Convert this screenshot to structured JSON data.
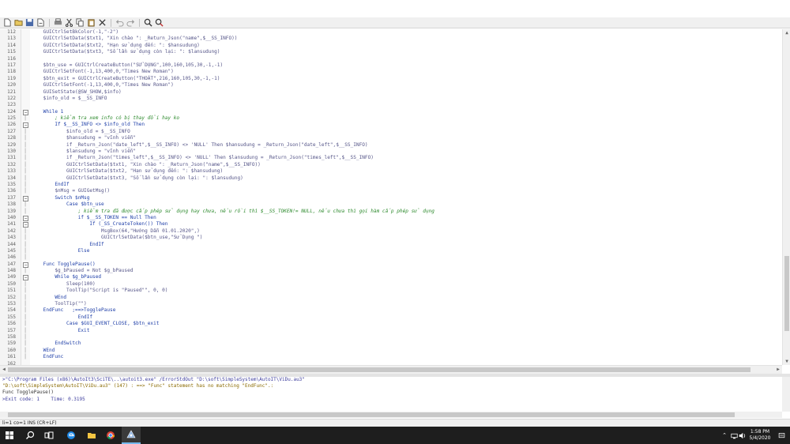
{
  "toolbar": {
    "icons": [
      "new-file-icon",
      "open-file-icon",
      "save-icon",
      "save-as-icon",
      "print-icon",
      "cut-icon",
      "copy-icon",
      "paste-icon",
      "close-icon",
      "undo-icon",
      "redo-icon",
      "find-icon",
      "replace-icon"
    ]
  },
  "code_lines": [
    {
      "n": "112",
      "t": "    GUICtrlSetBkColor(-1,\"-2\")",
      "k": "fn",
      "f": ""
    },
    {
      "n": "113",
      "t": "    GUICtrlSetData($txt1, \"Xin chào \": _Return_Json(\"name\",$__SS_INFO))",
      "k": "fn",
      "f": ""
    },
    {
      "n": "114",
      "t": "    GUICtrlSetData($txt2, \"Hạn sử dụng đến: \": $hansudung)",
      "k": "fn",
      "f": ""
    },
    {
      "n": "115",
      "t": "    GUICtrlSetData($txt3, \"Số lần sử dụng còn lại: \": $lansudung)",
      "k": "fn",
      "f": ""
    },
    {
      "n": "116",
      "t": "",
      "k": "fn",
      "f": ""
    },
    {
      "n": "117",
      "t": "    $btn_use = GUICtrlCreateButton(\"SỬ DỤNG\",100,160,105,30,-1,-1)",
      "k": "fn",
      "f": ""
    },
    {
      "n": "118",
      "t": "    GUICtrlSetFont(-1,13,400,0,\"Times New Roman\")",
      "k": "fn",
      "f": ""
    },
    {
      "n": "119",
      "t": "    $btn_exit = GUICtrlCreateButton(\"THOÁT\",216,160,105,30,-1,-1)",
      "k": "fn",
      "f": ""
    },
    {
      "n": "120",
      "t": "    GUICtrlSetFont(-1,13,400,0,\"Times New Roman\")",
      "k": "fn",
      "f": ""
    },
    {
      "n": "121",
      "t": "    GUISetState(@SW_SHOW,$info)",
      "k": "fn",
      "f": ""
    },
    {
      "n": "122",
      "t": "    $info_old = $__SS_INFO",
      "k": "fn",
      "f": ""
    },
    {
      "n": "123",
      "t": "",
      "k": "fn",
      "f": ""
    },
    {
      "n": "124",
      "t": "    While 1",
      "k": "kw",
      "f": "box"
    },
    {
      "n": "125",
      "t": "        ; kiểm tra xem info có bị thay đổi hay ko",
      "k": "cm",
      "f": "line"
    },
    {
      "n": "126",
      "t": "        If $__SS_INFO <> $info_old Then",
      "k": "kw",
      "f": "box"
    },
    {
      "n": "127",
      "t": "            $info_old = $__SS_INFO",
      "k": "fn",
      "f": "line"
    },
    {
      "n": "128",
      "t": "            $hansudung = \"vĩnh viễn\"",
      "k": "fn",
      "f": "line"
    },
    {
      "n": "129",
      "t": "            if _Return_Json(\"date_left\",$__SS_INFO) <> 'NULL' Then $hansudung = _Return_Json(\"date_left\",$__SS_INFO)",
      "k": "fn",
      "f": "line"
    },
    {
      "n": "130",
      "t": "            $lansudung = \"vĩnh viễn\"",
      "k": "fn",
      "f": "line"
    },
    {
      "n": "131",
      "t": "            if _Return_Json(\"times_left\",$__SS_INFO) <> 'NULL' Then $lansudung = _Return_Json(\"times_left\",$__SS_INFO)",
      "k": "fn",
      "f": "line"
    },
    {
      "n": "132",
      "t": "            GUICtrlSetData($txt1, \"Xin chào \": _Return_Json(\"name\",$__SS_INFO))",
      "k": "fn",
      "f": "line"
    },
    {
      "n": "133",
      "t": "            GUICtrlSetData($txt2, \"Hạn sử dụng đến: \": $hansudung)",
      "k": "fn",
      "f": "line"
    },
    {
      "n": "134",
      "t": "            GUICtrlSetData($txt3, \"Số lần sử dụng còn lại: \": $lansudung)",
      "k": "fn",
      "f": "line"
    },
    {
      "n": "135",
      "t": "        EndIf",
      "k": "kw",
      "f": "line"
    },
    {
      "n": "136",
      "t": "        $nMsg = GUIGetMsg()",
      "k": "fn",
      "f": "line"
    },
    {
      "n": "137",
      "t": "        Switch $nMsg",
      "k": "kw",
      "f": "box"
    },
    {
      "n": "138",
      "t": "            Case $btn_use",
      "k": "kw",
      "f": "line"
    },
    {
      "n": "139",
      "t": "                ; kiểm tra đã được cấp phép sử dụng hay chưa, nếu rồi thì $__SS_TOKEN!= NULL, nếu chưa thì gọi hàm cấp phép sử dụng",
      "k": "cm",
      "f": "line"
    },
    {
      "n": "140",
      "t": "                if $__SS_TOKEN == Null Then",
      "k": "kw",
      "f": "box"
    },
    {
      "n": "141",
      "t": "                    If (_SS_CreateToken()) Then",
      "k": "kw",
      "f": "box"
    },
    {
      "n": "142",
      "t": "                        MsgBox(64,\"Hướng Dẫn 01.01.2020\",)",
      "k": "fn",
      "f": "line"
    },
    {
      "n": "143",
      "t": "                        GUICtrlSetData($btn_use,\"Sử Dụng \")",
      "k": "fn",
      "f": "line"
    },
    {
      "n": "144",
      "t": "                    EndIf",
      "k": "kw",
      "f": "line"
    },
    {
      "n": "145",
      "t": "                Else",
      "k": "kw",
      "f": "line"
    },
    {
      "n": "146",
      "t": "",
      "k": "fn",
      "f": "line"
    },
    {
      "n": "147",
      "t": "    Func TogglePause()",
      "k": "kw",
      "f": "box"
    },
    {
      "n": "148",
      "t": "        $g_bPaused = Not $g_bPaused",
      "k": "fn",
      "f": "line"
    },
    {
      "n": "149",
      "t": "        While $g_bPaused",
      "k": "kw",
      "f": "box"
    },
    {
      "n": "150",
      "t": "            Sleep(100)",
      "k": "fn",
      "f": "line"
    },
    {
      "n": "151",
      "t": "            ToolTip(\"Script is \"Paused\"\", 0, 0)",
      "k": "fn",
      "f": "line"
    },
    {
      "n": "152",
      "t": "        WEnd",
      "k": "kw",
      "f": "line"
    },
    {
      "n": "153",
      "t": "        ToolTip(\"\")",
      "k": "fn",
      "f": "line"
    },
    {
      "n": "154",
      "t": "    EndFunc   ;==>TogglePause",
      "k": "kw",
      "f": "line"
    },
    {
      "n": "155",
      "t": "                EndIf",
      "k": "kw",
      "f": "line"
    },
    {
      "n": "156",
      "t": "            Case $GUI_EVENT_CLOSE, $btn_exit",
      "k": "kw",
      "f": "line"
    },
    {
      "n": "157",
      "t": "                Exit",
      "k": "kw",
      "f": "line"
    },
    {
      "n": "158",
      "t": "",
      "k": "fn",
      "f": "line"
    },
    {
      "n": "159",
      "t": "        EndSwitch",
      "k": "kw",
      "f": "line"
    },
    {
      "n": "160",
      "t": "    WEnd",
      "k": "kw",
      "f": "line"
    },
    {
      "n": "161",
      "t": "    EndFunc",
      "k": "kw",
      "f": "line"
    },
    {
      "n": "162",
      "t": "",
      "k": "fn",
      "f": ""
    }
  ],
  "output": {
    "line1": ">\"C:\\Program Files (x86)\\AutoIt3\\SciTE\\..\\autoit3.exe\" /ErrorStdOut \"D:\\soft\\SimpleSystem\\AutoIT\\ViDu.au3\"",
    "line2": "\"D:\\soft\\SimpleSystem\\AutoIT\\ViDu.au3\" (147) : ==> \"Func\" statement has no matching \"EndFunc\".:",
    "line3": "Func TogglePause()",
    "line4": "",
    "line5": ">Exit code: 1    Time: 0.3195"
  },
  "statusbar": {
    "text": "li=1 co=1 INS (CR+LF)"
  },
  "taskbar": {
    "time": "1:58 PM",
    "date": "5/4/2020"
  },
  "colors": {
    "keyword": "#1f3fa8",
    "comment": "#2d8a2d",
    "taskbar": "#1e1e1e"
  }
}
